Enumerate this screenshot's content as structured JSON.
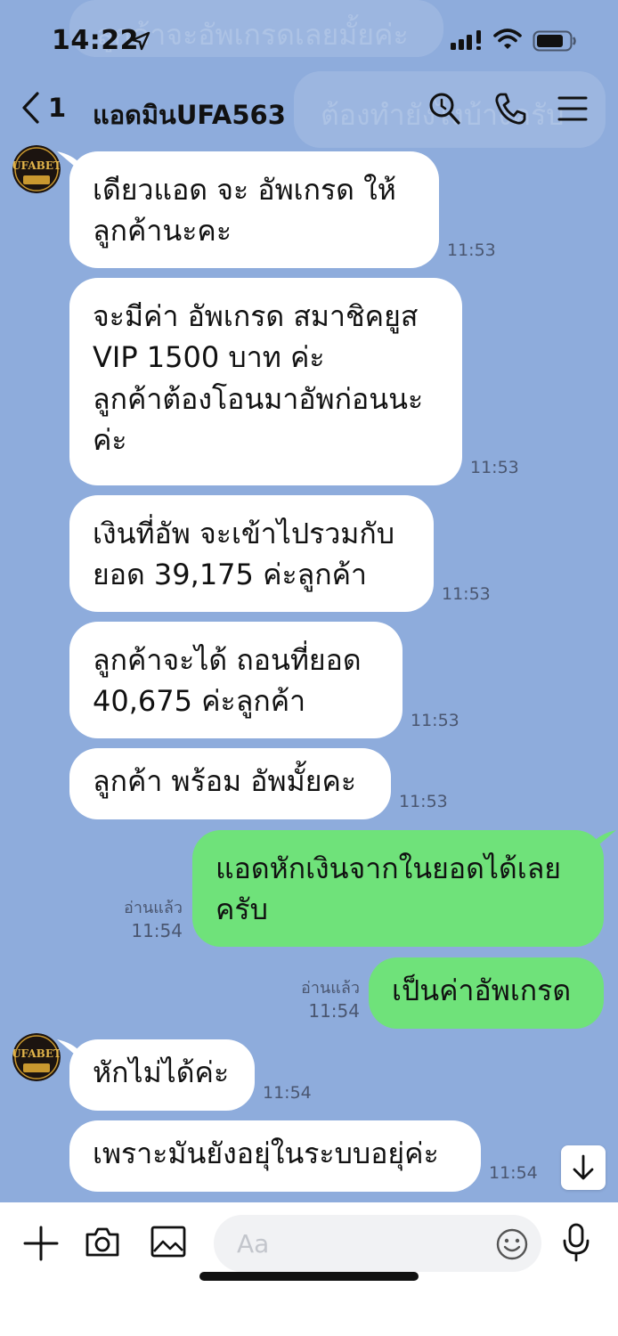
{
  "status_bar": {
    "time": "14:22"
  },
  "header": {
    "back_count": "1",
    "title": "แอดมินUFA563"
  },
  "ghost_text": {
    "line1": "ลูกค้าจะอัพเกรดเลยมั้ยค่ะ",
    "line2": "ต้องทำยังไงบ้างครับ"
  },
  "avatar_label": "UFABET",
  "messages": [
    {
      "side": "in",
      "text": "เดียวแอด จะ อัพเกรด ให้\nลูกค้านะคะ",
      "time": "11:53"
    },
    {
      "side": "in",
      "text": "จะมีค่า อัพเกรด สมาชิคยูส\nVIP 1500 บาท ค่ะ\nลูกค้าต้องโอนมาอัพก่อนนะ\nค่ะ",
      "time": "11:53"
    },
    {
      "side": "in",
      "text": "เงินที่อัพ จะเข้าไปรวมกับ\nยอด 39,175 ค่ะลูกค้า",
      "time": "11:53"
    },
    {
      "side": "in",
      "text": "ลูกค้าจะได้ ถอนที่ยอด\n40,675 ค่ะลูกค้า",
      "time": "11:53"
    },
    {
      "side": "in",
      "text": "ลูกค้า พร้อม อัพมั้ยคะ",
      "time": "11:53"
    },
    {
      "side": "out",
      "text": "แอดหักเงินจากในยอดได้เลย\nครับ",
      "read": "อ่านแล้ว",
      "time": "11:54"
    },
    {
      "side": "out",
      "text": "เป็นค่าอัพเกรด",
      "read": "อ่านแล้ว",
      "time": "11:54"
    },
    {
      "side": "in",
      "text": "หักไม่ได้ค่ะ",
      "time": "11:54"
    },
    {
      "side": "in",
      "text": "เพราะมันยังอยุ่ในระบบอยุ่ค่ะ",
      "time": "11:54"
    }
  ],
  "input": {
    "placeholder": "Aa"
  },
  "icons": {
    "status": [
      "location-arrow-icon",
      "signal-icon",
      "wifi-icon",
      "battery-icon"
    ],
    "header": [
      "back-chevron-icon",
      "search-icon",
      "phone-icon",
      "menu-icon"
    ],
    "input_bar": [
      "plus-icon",
      "camera-icon",
      "image-icon",
      "emoji-icon",
      "microphone-icon"
    ],
    "scroll": "arrow-down-icon"
  },
  "colors": {
    "background": "#8eacdc",
    "incoming_bubble": "#ffffff",
    "outgoing_bubble": "#6fe27a"
  }
}
